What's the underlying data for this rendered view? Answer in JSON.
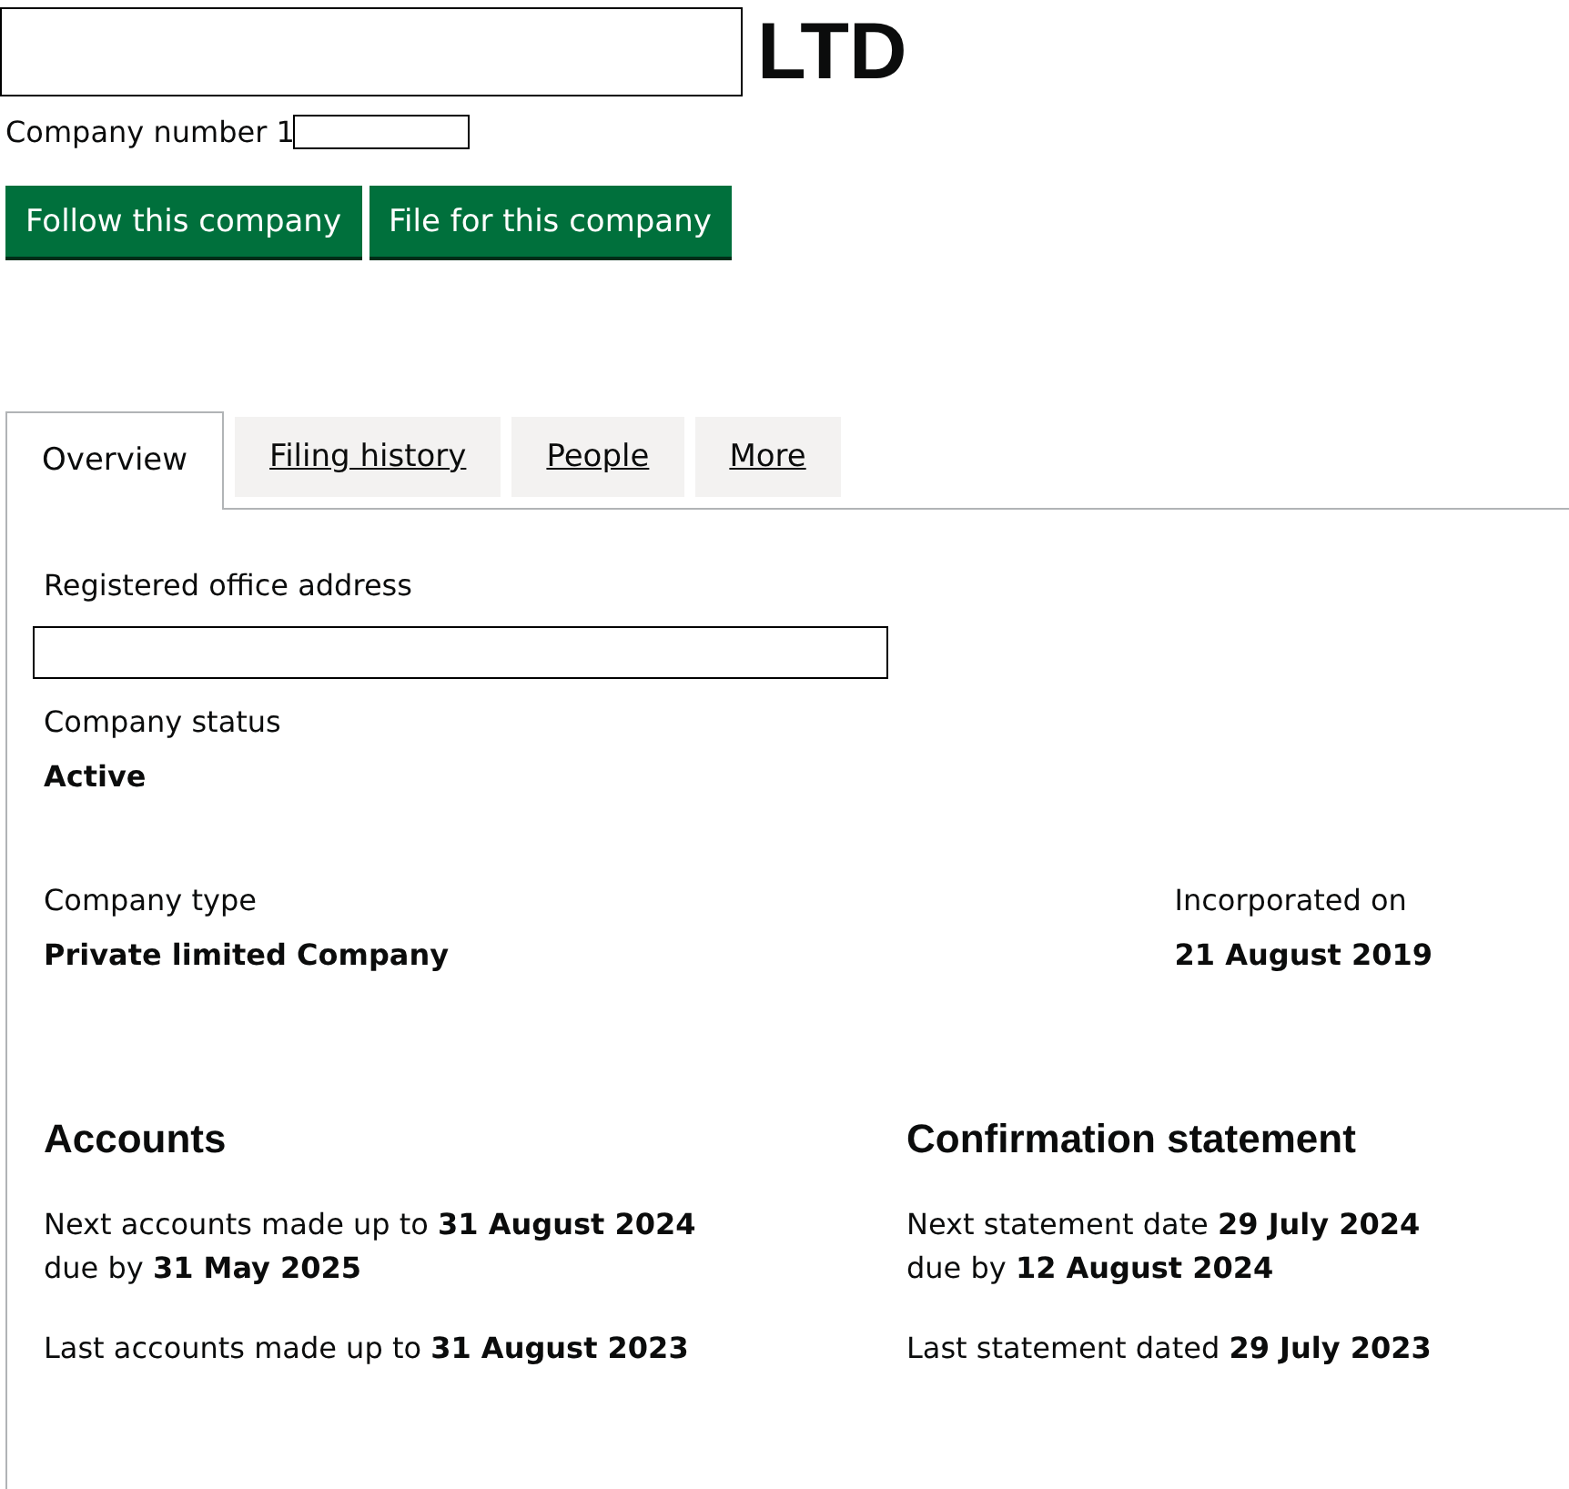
{
  "header": {
    "title": "LTD",
    "company_number": "Company number 1"
  },
  "buttons": [
    {
      "label": "Follow this company"
    },
    {
      "label": "File for this company"
    }
  ],
  "tabs": [
    {
      "label": "Overview",
      "selected": true
    },
    {
      "label": "Filing history",
      "selected": false
    },
    {
      "label": "People",
      "selected": false
    },
    {
      "label": "More",
      "selected": false
    }
  ],
  "overview": {
    "registered_office_label": "Registered office address",
    "status_label": "Company status",
    "status": "Active",
    "type_label": "Company type",
    "type": "Private limited Company",
    "incorporated_label": "Incorporated on",
    "incorporated": "21 August 2019"
  },
  "accounts": {
    "heading": "Accounts",
    "next": "Next accounts made up to **31 August 2024**",
    "due": "due by **31 May 2025**",
    "last": "Last accounts made up to **31 August 2023**"
  },
  "confirmation": {
    "heading": "Confirmation statement",
    "next": "Next statement date **29 July 2024**",
    "due": "due by **12 August 2024**",
    "last": "Last statement dated **29 July 2023**"
  }
}
